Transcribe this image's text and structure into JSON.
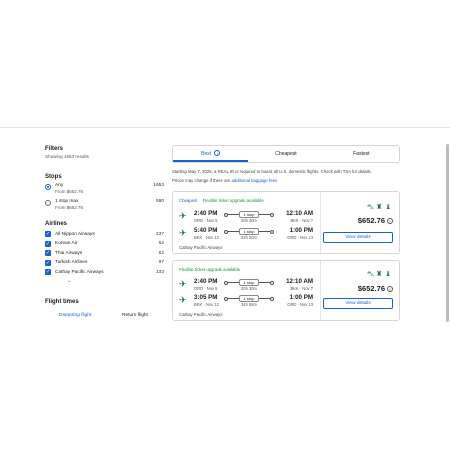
{
  "filters": {
    "title": "Filters",
    "showing": "Showing 1653 results"
  },
  "stops": {
    "title": "Stops",
    "options": [
      {
        "label": "Any",
        "sub": "From $652.76",
        "count": "1653",
        "selected": true
      },
      {
        "label": "1 stop max",
        "sub": "From $652.76",
        "count": "590",
        "selected": false
      }
    ]
  },
  "airlines": {
    "title": "Airlines",
    "items": [
      {
        "label": "All Nippon Airways",
        "count": "237"
      },
      {
        "label": "Korean Air",
        "count": "52"
      },
      {
        "label": "Thai Airways",
        "count": "62"
      },
      {
        "label": "Turkish Airlines",
        "count": "97"
      },
      {
        "label": "Cathay Pacific Airways",
        "count": "133"
      }
    ],
    "show_more_icon": "chevron-down"
  },
  "flight_times": {
    "title": "Flight times",
    "tabs": [
      "Departing flight",
      "Return flight"
    ]
  },
  "sort_tabs": [
    "Best",
    "Cheapest",
    "Fastest"
  ],
  "notice": {
    "text": "Starting May 7, 2025, a REAL ID is required to board all U.S. domestic flights. Check with TSA for details.",
    "fees_text": "Prices may change if there are",
    "fees_link": "additional baggage fees"
  },
  "cards": [
    {
      "badges": {
        "cheapest": "Cheapest",
        "flex": "Flexible ticket upgrade available"
      },
      "legs": [
        {
          "depart": "2:40 PM",
          "depart_sub": "ORD · Nov 5",
          "stop": "1 stop",
          "duration": "20h 30m",
          "arrive": "12:10 AM",
          "arrive_sub": "BKK · Nov 7"
        },
        {
          "depart": "5:40 PM",
          "depart_sub": "BKK · Nov 12",
          "stop": "1 stop",
          "duration": "22h 20m",
          "arrive": "1:00 PM",
          "arrive_sub": "ORD · Nov 13"
        }
      ],
      "airline": "Cathay Pacific Airways",
      "price": "$652.76",
      "button": "View details"
    },
    {
      "badges": {
        "flex": "Flexible ticket upgrade available"
      },
      "legs": [
        {
          "depart": "2:40 PM",
          "depart_sub": "ORD · Nov 5",
          "stop": "1 stop",
          "duration": "20h 30m",
          "arrive": "12:10 AM",
          "arrive_sub": "BKK · Nov 7"
        },
        {
          "depart": "3:05 PM",
          "depart_sub": "BKK · Nov 12",
          "stop": "1 stop",
          "duration": "34h 55m",
          "arrive": "1:00 PM",
          "arrive_sub": "ORD · Nov 13"
        }
      ],
      "airline": "Cathay Pacific Airways",
      "price": "$652.76",
      "button": "View details"
    }
  ],
  "colors": {
    "accent": "#1a5fd0",
    "flex_green": "#1e8a3c",
    "icon_teal": "#1e6f5c"
  }
}
